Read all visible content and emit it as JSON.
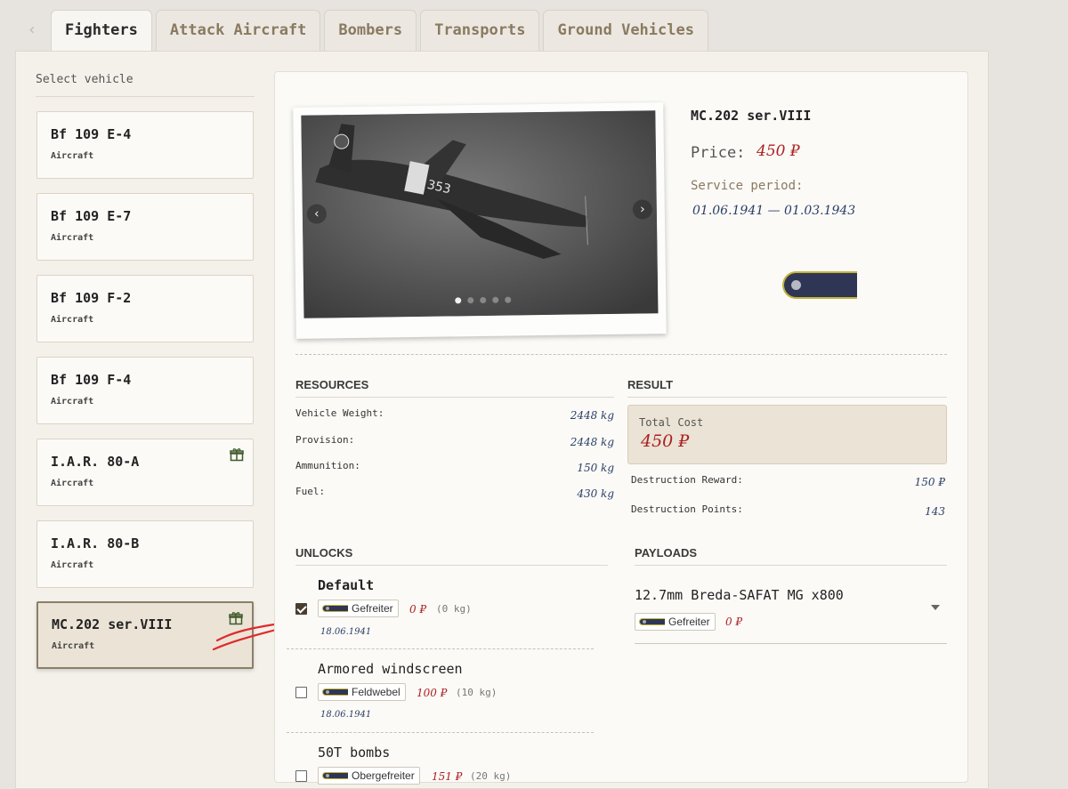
{
  "tabs": {
    "back_glyph": "‹",
    "items": [
      {
        "label": "Fighters"
      },
      {
        "label": "Attack Aircraft"
      },
      {
        "label": "Bombers"
      },
      {
        "label": "Transports"
      },
      {
        "label": "Ground Vehicles"
      }
    ]
  },
  "sidebar": {
    "title": "Select vehicle",
    "vehicles": [
      {
        "name": "Bf 109 E-4",
        "type": "Aircraft"
      },
      {
        "name": "Bf 109 E-7",
        "type": "Aircraft"
      },
      {
        "name": "Bf 109 F-2",
        "type": "Aircraft"
      },
      {
        "name": "Bf 109 F-4",
        "type": "Aircraft"
      },
      {
        "name": "I.A.R. 80-A",
        "type": "Aircraft"
      },
      {
        "name": "I.A.R. 80-B",
        "type": "Aircraft"
      },
      {
        "name": "MC.202 ser.VIII",
        "type": "Aircraft"
      }
    ]
  },
  "detail": {
    "title": "MC.202 ser.VIII",
    "price_label": "Price:",
    "price_value": "450 ₽",
    "service_label": "Service period:",
    "service_value": "01.06.1941 — 01.03.1943",
    "photo_marking": "353",
    "photo_prev": "‹",
    "photo_next": "›"
  },
  "resources": {
    "title": "RESOURCES",
    "rows": [
      {
        "label": "Vehicle Weight:",
        "value": "2448 kg"
      },
      {
        "label": "Provision:",
        "value": "2448 kg"
      },
      {
        "label": "Ammunition:",
        "value": "150 kg"
      },
      {
        "label": "Fuel:",
        "value": "430 kg"
      }
    ]
  },
  "result": {
    "title": "RESULT",
    "total_label": "Total Cost",
    "total_value": "450 ₽",
    "rows": [
      {
        "label": "Destruction Reward:",
        "value": "150 ₽"
      },
      {
        "label": "Destruction Points:",
        "value": "143"
      }
    ]
  },
  "unlocks": {
    "title": "UNLOCKS",
    "items": [
      {
        "name": "Default",
        "rank": "Gefreiter",
        "price": "0 ₽",
        "weight": "(0 kg)",
        "date": "18.06.1941"
      },
      {
        "name": "Armored windscreen",
        "rank": "Feldwebel",
        "price": "100 ₽",
        "weight": "(10 kg)",
        "date": "18.06.1941"
      },
      {
        "name": "50T bombs",
        "rank": "Obergefreiter",
        "price": "151 ₽",
        "weight": "(20 kg)",
        "date": ""
      }
    ]
  },
  "payloads": {
    "title": "PAYLOADS",
    "selected": "12.7mm Breda-SAFAT MG x800",
    "rank": "Gefreiter",
    "price": "0 ₽"
  },
  "colors": {
    "price_red": "#aa2222",
    "date_blue": "#2a3e66",
    "rank_navy": "#2f3655",
    "rank_gold": "#c4b33a"
  }
}
